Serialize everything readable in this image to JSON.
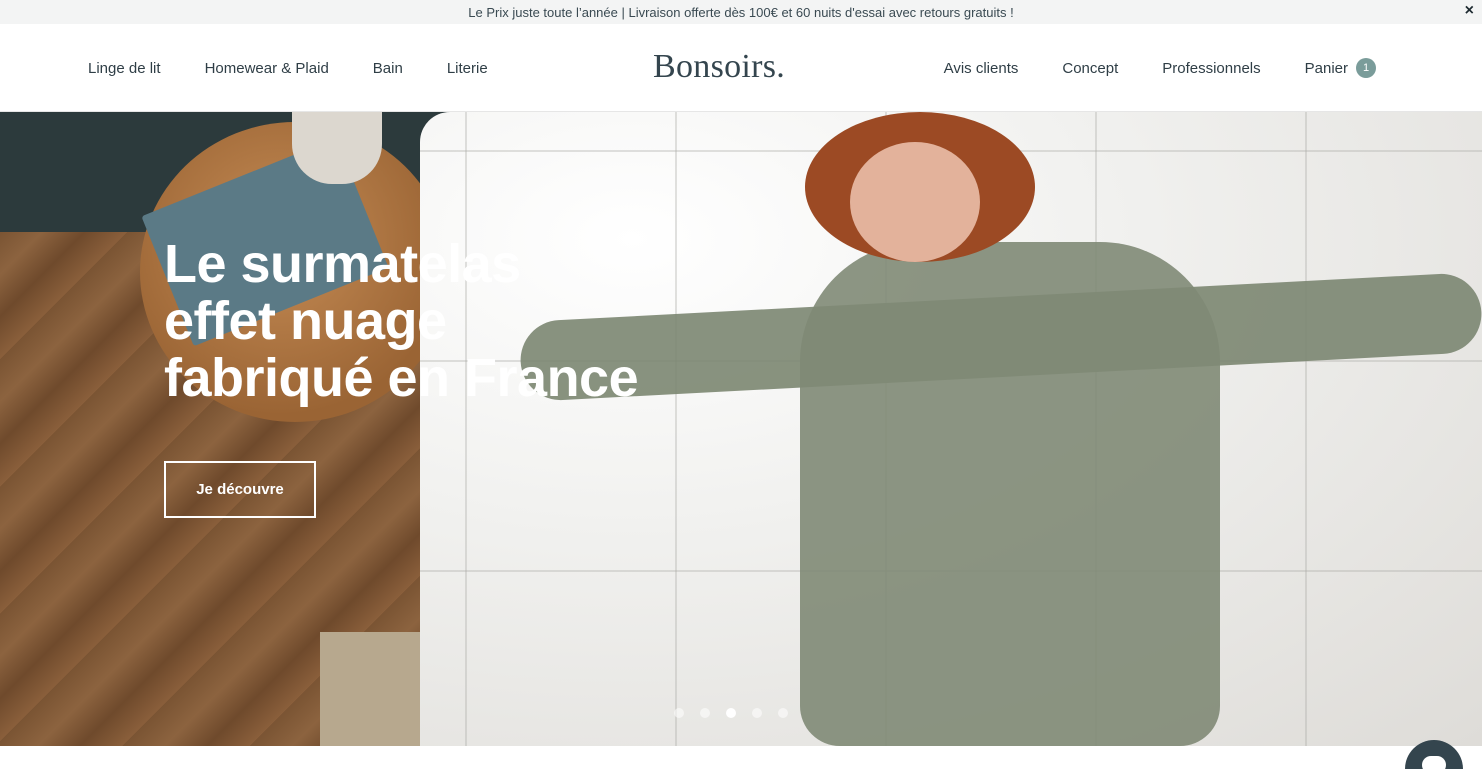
{
  "announcement": {
    "text": "Le Prix juste toute l’année | Livraison offerte dès 100€ et 60 nuits d'essai avec retours gratuits !",
    "close_label": "×"
  },
  "header": {
    "logo": "Bonsoirs.",
    "nav_left": [
      "Linge de lit",
      "Homewear & Plaid",
      "Bain",
      "Literie"
    ],
    "nav_right": [
      "Avis clients",
      "Concept",
      "Professionnels"
    ],
    "cart": {
      "label": "Panier",
      "count": "1"
    }
  },
  "hero": {
    "title_lines": [
      "Le surmatelas",
      "effet nuage",
      "fabriqué en France"
    ],
    "cta_label": "Je découvre",
    "carousel": {
      "slides": 5,
      "active_index": 2
    }
  },
  "chat": {
    "icon": "chat-bubble-icon"
  },
  "colors": {
    "text": "#2f3e46",
    "badge": "#7a9c9a",
    "chat_button": "#34454e"
  }
}
